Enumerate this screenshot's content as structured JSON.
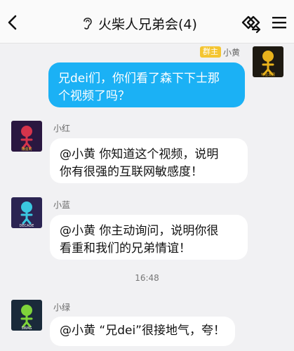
{
  "header": {
    "title": "火柴人兄弟会(4)",
    "back_icon": "chevron-left-icon",
    "ear_icon": "ear-icon",
    "share_icon": "group-share-icon",
    "menu_icon": "hamburger-menu-icon"
  },
  "messages": [
    {
      "sender": "小黄",
      "badge": "群主",
      "text_line1": "兄dei们，你们看了森下下士那",
      "text_line2": "个视频了吗？",
      "avatar_caption": "特征发展"
    },
    {
      "sender": "小红",
      "text_line1": "@小黄 你知道这个视频，说明",
      "text_line2": "你有很强的互联网敏感度！",
      "avatar_caption": "赚强到"
    },
    {
      "sender": "小蓝",
      "text_line1": "@小黄  你主动询问，说明你很",
      "text_line2": "看重和我们的兄弟情谊！",
      "avatar_caption": "DECADE"
    },
    {
      "sender": "小绿",
      "text_line1": "@小黄 “兄dei”很接地气，夸！",
      "avatar_caption": "SWAG"
    }
  ],
  "timestamp": "16:48",
  "colors": {
    "accent_blue": "#1bb1f5",
    "badge_yellow": "#f4c531",
    "background": "#f1f1f3"
  }
}
